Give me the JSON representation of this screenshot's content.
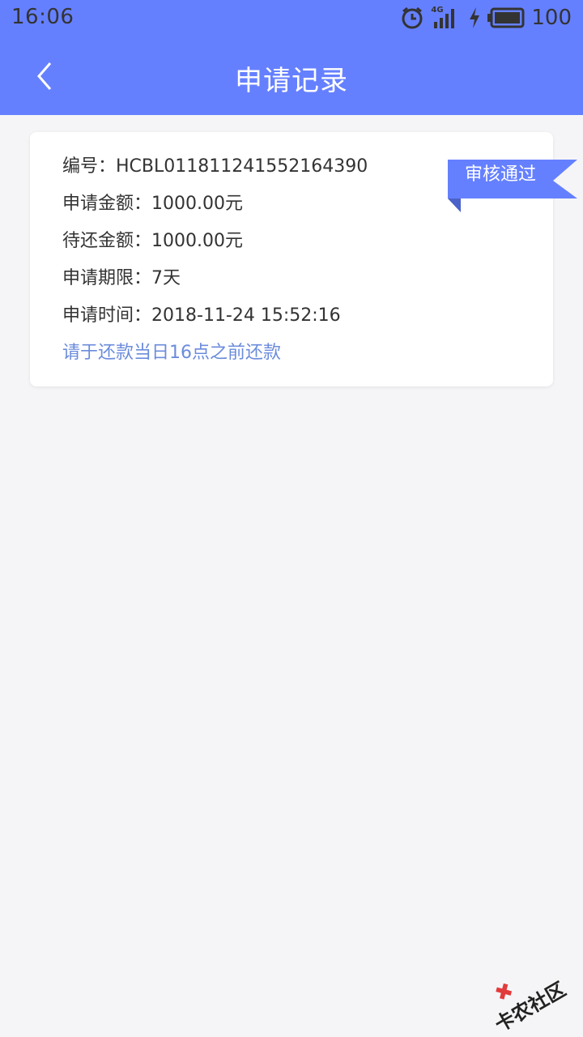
{
  "status_bar": {
    "time": "16:06",
    "network": "4G",
    "battery": "100",
    "icons": [
      "alarm-icon",
      "signal-icon",
      "charging-icon",
      "battery-icon"
    ]
  },
  "header": {
    "title": "申请记录",
    "back_icon": "chevron-left-icon",
    "bg_color": "#6580ff"
  },
  "record": {
    "badge": "审核通过",
    "rows": [
      {
        "label": "编号：",
        "value": "HCBL011811241552164390"
      },
      {
        "label": "申请金额：",
        "value": "1000.00元"
      },
      {
        "label": "待还金额：",
        "value": "1000.00元"
      },
      {
        "label": "申请期限：",
        "value": "7天"
      },
      {
        "label": "申请时间：",
        "value": "2018-11-24 15:52:16"
      }
    ],
    "note": "请于还款当日16点之前还款",
    "note_color": "#6b8cdc"
  },
  "watermark": {
    "text": "卡农社区"
  }
}
